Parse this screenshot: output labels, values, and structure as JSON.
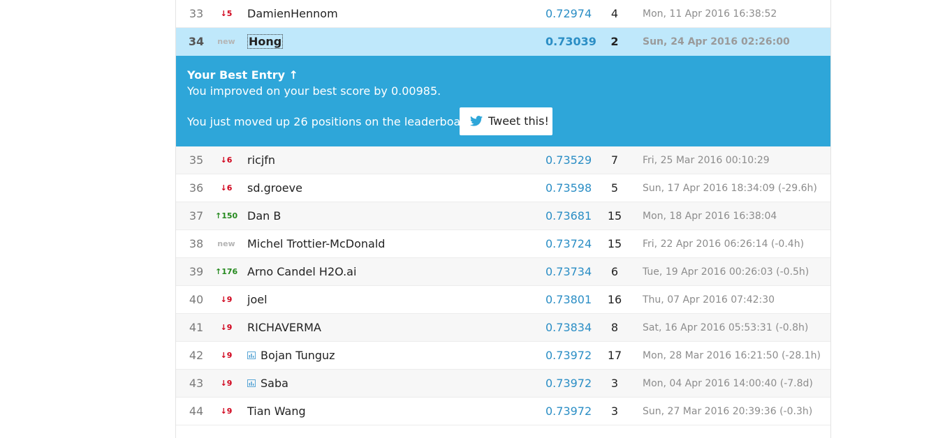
{
  "leaderboard": {
    "rows_before": [
      {
        "rank": "33",
        "delta": "↓5",
        "delta_type": "down",
        "team": "DamienHennom",
        "has_icon": false,
        "score": "0.72974",
        "entries": "4",
        "last": "Mon, 11 Apr 2016 16:38:52"
      }
    ],
    "me": {
      "rank": "34",
      "delta": "new",
      "team": "Hong",
      "score": "0.73039",
      "entries": "2",
      "last": "Sun, 24 Apr 2016 02:26:00"
    },
    "banner": {
      "title": "Your Best Entry ↑",
      "improved": "You improved on your best score by 0.00985.",
      "moved": "You just moved up 26 positions on the leaderboard.",
      "tweet_label": "Tweet this!",
      "tweet_icon": "twitter-bird-icon",
      "color": "#2ea6d9"
    },
    "rows_after": [
      {
        "rank": "35",
        "delta": "↓6",
        "delta_type": "down",
        "team": "ricjfn",
        "has_icon": false,
        "score": "0.73529",
        "entries": "7",
        "last": "Fri, 25 Mar 2016 00:10:29"
      },
      {
        "rank": "36",
        "delta": "↓6",
        "delta_type": "down",
        "team": "sd.groeve",
        "has_icon": false,
        "score": "0.73598",
        "entries": "5",
        "last": "Sun, 17 Apr 2016 18:34:09 (-29.6h)"
      },
      {
        "rank": "37",
        "delta": "↑150",
        "delta_type": "up",
        "team": "Dan B",
        "has_icon": false,
        "score": "0.73681",
        "entries": "15",
        "last": "Mon, 18 Apr 2016 16:38:04"
      },
      {
        "rank": "38",
        "delta": "new",
        "delta_type": "new",
        "team": "Michel Trottier-McDonald",
        "has_icon": false,
        "score": "0.73724",
        "entries": "15",
        "last": "Fri, 22 Apr 2016 06:26:14 (-0.4h)"
      },
      {
        "rank": "39",
        "delta": "↑176",
        "delta_type": "up",
        "team": "Arno Candel H2O.ai",
        "has_icon": false,
        "score": "0.73734",
        "entries": "6",
        "last": "Tue, 19 Apr 2016 00:26:03 (-0.5h)"
      },
      {
        "rank": "40",
        "delta": "↓9",
        "delta_type": "down",
        "team": "joel",
        "has_icon": false,
        "score": "0.73801",
        "entries": "16",
        "last": "Thu, 07 Apr 2016 07:42:30"
      },
      {
        "rank": "41",
        "delta": "↓9",
        "delta_type": "down",
        "team": "RICHAVERMA",
        "has_icon": false,
        "score": "0.73834",
        "entries": "8",
        "last": "Sat, 16 Apr 2016 05:53:31 (-0.8h)"
      },
      {
        "rank": "42",
        "delta": "↓9",
        "delta_type": "down",
        "team": "Bojan Tunguz",
        "has_icon": true,
        "score": "0.73972",
        "entries": "17",
        "last": "Mon, 28 Mar 2016 16:21:50 (-28.1h)"
      },
      {
        "rank": "43",
        "delta": "↓9",
        "delta_type": "down",
        "team": "Saba",
        "has_icon": true,
        "score": "0.73972",
        "entries": "3",
        "last": "Mon, 04 Apr 2016 14:00:40 (-7.8d)"
      },
      {
        "rank": "44",
        "delta": "↓9",
        "delta_type": "down",
        "team": "Tian Wang",
        "has_icon": false,
        "score": "0.73972",
        "entries": "3",
        "last": "Sun, 27 Mar 2016 20:39:36 (-0.3h)"
      }
    ]
  },
  "colors": {
    "score": "#2b8ec5",
    "down": "#d0021b",
    "up": "#268a1f",
    "highlight": "#bfe8fb"
  }
}
